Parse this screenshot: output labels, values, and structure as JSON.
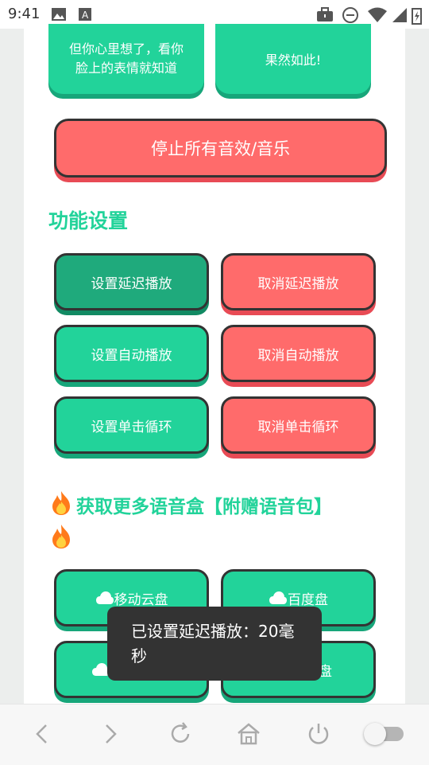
{
  "status_bar": {
    "time": "9:41"
  },
  "top_buttons": [
    {
      "label": "但你心里想了，看你\n脸上的表情就知道"
    },
    {
      "label": "果然如此!"
    }
  ],
  "stop_all": {
    "label": "停止所有音效/音乐"
  },
  "section_function": {
    "title": "功能设置"
  },
  "function_buttons": [
    {
      "label": "设置延迟播放"
    },
    {
      "label": "取消延迟播放"
    },
    {
      "label": "设置自动播放"
    },
    {
      "label": "取消自动播放"
    },
    {
      "label": "设置单击循环"
    },
    {
      "label": "取消单击循环"
    }
  ],
  "section_more": {
    "title": "获取更多语音盒【附赠语音包】"
  },
  "download_buttons": [
    {
      "label": "移动云盘"
    },
    {
      "label": "百度盘"
    },
    {
      "label": "盘"
    }
  ],
  "toast": {
    "text": "已设置延迟播放：20毫秒"
  },
  "colors": {
    "green": "#22d39a",
    "red": "#ff6b6b",
    "dark": "#333333"
  }
}
